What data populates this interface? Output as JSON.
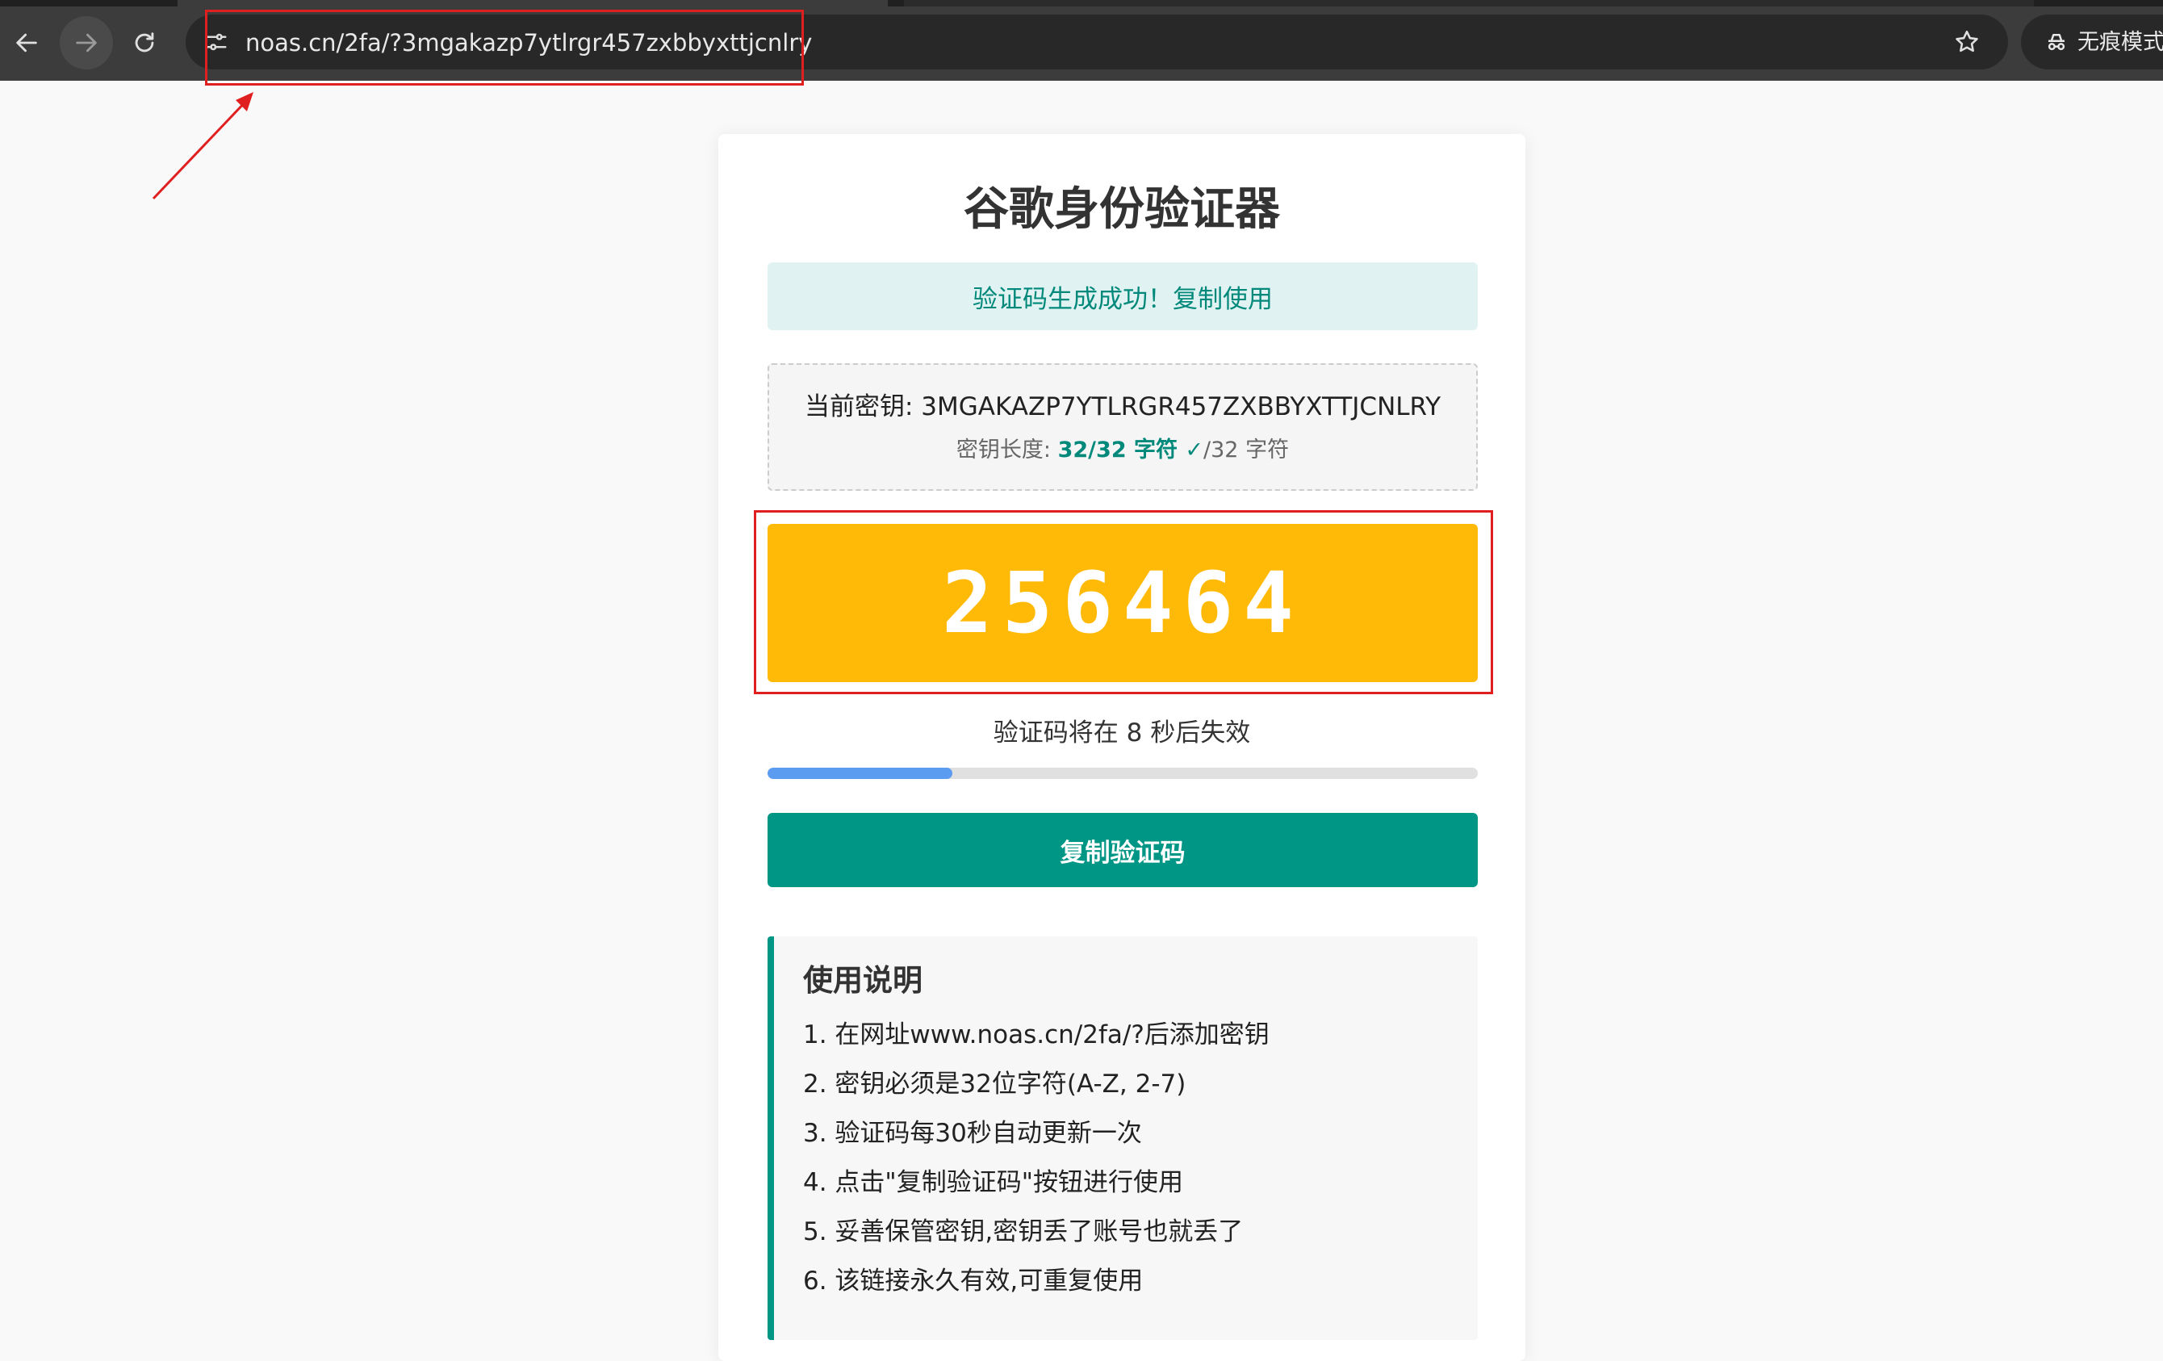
{
  "browser": {
    "url": "noas.cn/2fa/?3mgakazp7ytlrgr457zxbbyxttjcnlry",
    "incognito_label": "无痕模式"
  },
  "page": {
    "title": "谷歌身份验证器",
    "success_message": "验证码生成成功！复制使用",
    "key_label": "当前密钥: ",
    "key_value": "3MGAKAZP7YTLRGR457ZXBBYXTTJCNLRY",
    "length_label": "密钥长度: ",
    "length_value": "32/32 字符 ✓",
    "length_suffix": "/32 字符",
    "code": "256464",
    "expire_text": "验证码将在 8 秒后失效",
    "progress_fraction": 0.26,
    "copy_button": "复制验证码",
    "instructions_title": "使用说明",
    "instructions": [
      "1. 在网址www.noas.cn/2fa/?后添加密钥",
      "2. 密钥必须是32位字符(A-Z, 2-7)",
      "3. 验证码每30秒自动更新一次",
      "4. 点击\"复制验证码\"按钮进行使用",
      "5. 妥善保管密钥,密钥丢了账号也就丢了",
      "6. 该链接永久有效,可重复使用"
    ]
  },
  "colors": {
    "accent_teal": "#009685",
    "code_bg": "#ffb907",
    "progress": "#5b9bf0",
    "annotation_red": "#e02020"
  },
  "icons": [
    "back-icon",
    "forward-icon",
    "reload-icon",
    "site-info-icon",
    "bookmark-star-icon",
    "incognito-icon"
  ]
}
